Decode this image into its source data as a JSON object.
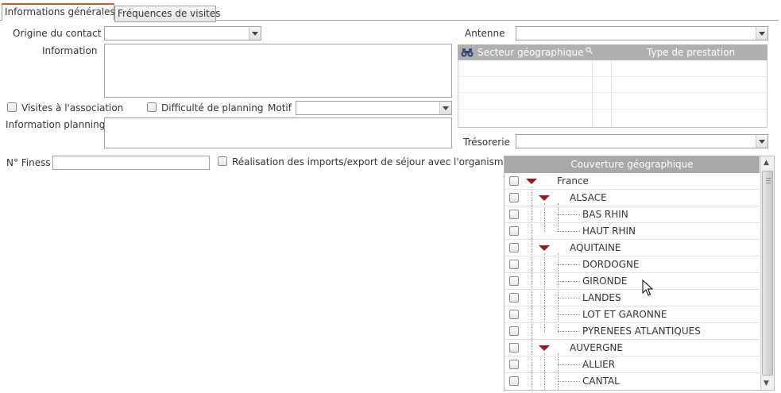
{
  "tabs": [
    {
      "label": "Informations générales",
      "active": true
    },
    {
      "label": "Fréquences de visites",
      "active": false
    }
  ],
  "form": {
    "origine_label": "Origine du contact",
    "origine_value": "",
    "information_label": "Information",
    "information_value": "",
    "visites_label": "Visites à l'association",
    "visites_checked": false,
    "difficulte_label": "Difficulté de planning",
    "difficulte_checked": false,
    "motif_label": "Motif",
    "motif_value": "",
    "info_planning_label": "Information planning",
    "info_planning_value": "",
    "finess_label": "N° Finess",
    "finess_value": "",
    "realisation_label": "Réalisation des imports/export de séjour avec l'organisme",
    "realisation_checked": false,
    "antenne_label": "Antenne",
    "antenne_value": "",
    "tresorerie_label": "Trésorerie",
    "tresorerie_value": ""
  },
  "secteur_grid": {
    "col1": "Secteur géographique",
    "col2": "Type de prestation",
    "rows": []
  },
  "coverage": {
    "header": "Couverture géographique",
    "rows": [
      {
        "label": "France",
        "level": 0,
        "expanded": true
      },
      {
        "label": "ALSACE",
        "level": 1,
        "expanded": true
      },
      {
        "label": "BAS RHIN",
        "level": 2
      },
      {
        "label": "HAUT RHIN",
        "level": 2
      },
      {
        "label": "AQUITAINE",
        "level": 1,
        "expanded": true
      },
      {
        "label": "DORDOGNE",
        "level": 2
      },
      {
        "label": "GIRONDE",
        "level": 2
      },
      {
        "label": "LANDES",
        "level": 2
      },
      {
        "label": "LOT ET GARONNE",
        "level": 2
      },
      {
        "label": "PYRENEES ATLANTIQUES",
        "level": 2
      },
      {
        "label": "AUVERGNE",
        "level": 1,
        "expanded": true
      },
      {
        "label": "ALLIER",
        "level": 2
      },
      {
        "label": "CANTAL",
        "level": 2
      }
    ]
  },
  "colors": {
    "active_tab_accent": "#d45a1e",
    "grid_header": "#b0b0b0",
    "tree_header": "#a8a8a8",
    "expand_triangle": "#a01818"
  },
  "icons": {
    "column_menu": "binoculars-icon",
    "search": "search-icon",
    "expand": "triangle-down-icon",
    "scroll_up": "chevron-up-icon",
    "scroll_down": "chevron-down-icon",
    "cursor": "mouse-pointer-icon"
  }
}
